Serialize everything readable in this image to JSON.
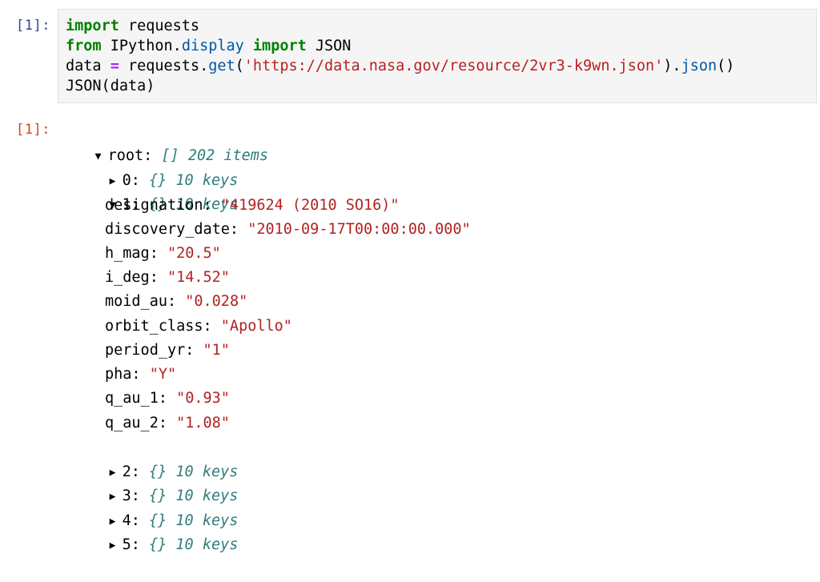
{
  "input_cell": {
    "prompt": "[1]:",
    "code": {
      "line1": {
        "kw": "import",
        "rest": " requests"
      },
      "line2": {
        "kw1": "from",
        "mod_a": " IPython",
        "dot": ".",
        "mod_b": "display",
        "kw2": " import",
        "rest": " JSON"
      },
      "line3": {
        "var": "data",
        "eq": " = ",
        "obj": "requests",
        "dot": ".",
        "fn": "get",
        "open": "(",
        "url": "'https://data.nasa.gov/resource/2vr3-k9wn.json'",
        "close": ")",
        "dot2": ".",
        "fn2": "json",
        "end": "()"
      },
      "line4": {
        "text": "JSON(data)"
      }
    }
  },
  "output_cell": {
    "prompt": "[1]:",
    "root": {
      "toggle": "▼",
      "label": "root:",
      "type": "[]",
      "count": "202 items"
    },
    "items": [
      {
        "toggle": "▶",
        "key": "0:",
        "type": "{}",
        "count": "10 keys"
      },
      {
        "toggle": "▼",
        "key": "1:",
        "type": "{}",
        "count": "10 keys"
      }
    ],
    "fields": [
      {
        "key": "designation:",
        "value": "\"419624 (2010 SO16)\""
      },
      {
        "key": "discovery_date:",
        "value": "\"2010-09-17T00:00:00.000\""
      },
      {
        "key": "h_mag:",
        "value": "\"20.5\""
      },
      {
        "key": "i_deg:",
        "value": "\"14.52\""
      },
      {
        "key": "moid_au:",
        "value": "\"0.028\""
      },
      {
        "key": "orbit_class:",
        "value": "\"Apollo\""
      },
      {
        "key": "period_yr:",
        "value": "\"1\""
      },
      {
        "key": "pha:",
        "value": "\"Y\""
      },
      {
        "key": "q_au_1:",
        "value": "\"0.93\""
      },
      {
        "key": "q_au_2:",
        "value": "\"1.08\""
      }
    ],
    "collapsed_items": [
      {
        "toggle": "▶",
        "key": "2:",
        "type": "{}",
        "count": "10 keys"
      },
      {
        "toggle": "▶",
        "key": "3:",
        "type": "{}",
        "count": "10 keys"
      },
      {
        "toggle": "▶",
        "key": "4:",
        "type": "{}",
        "count": "10 keys"
      },
      {
        "toggle": "▶",
        "key": "5:",
        "type": "{}",
        "count": "10 keys"
      }
    ]
  }
}
